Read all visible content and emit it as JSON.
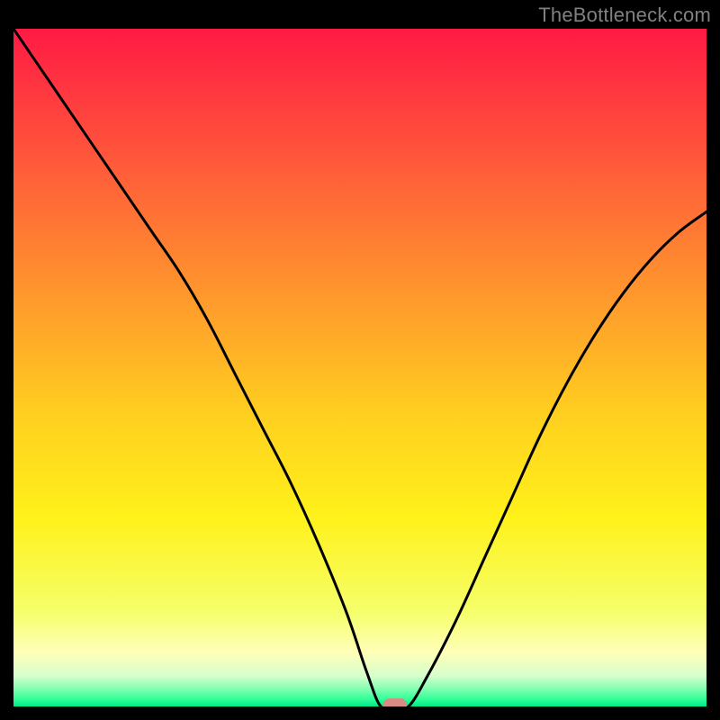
{
  "watermark": "TheBottleneck.com",
  "colors": {
    "black": "#000000",
    "watermark": "#808080",
    "curve": "#000000",
    "marker": "#d98b84",
    "gradient_stops": [
      {
        "offset": 0.0,
        "color": "#ff1a44"
      },
      {
        "offset": 0.2,
        "color": "#ff5a3a"
      },
      {
        "offset": 0.4,
        "color": "#ff9a2c"
      },
      {
        "offset": 0.58,
        "color": "#ffd21f"
      },
      {
        "offset": 0.72,
        "color": "#fff11a"
      },
      {
        "offset": 0.86,
        "color": "#f5ff6a"
      },
      {
        "offset": 0.92,
        "color": "#ffffb8"
      },
      {
        "offset": 0.955,
        "color": "#d6ffcc"
      },
      {
        "offset": 0.975,
        "color": "#7dffb0"
      },
      {
        "offset": 0.99,
        "color": "#2bff95"
      },
      {
        "offset": 1.0,
        "color": "#00e887"
      }
    ]
  },
  "chart_data": {
    "type": "line",
    "title": "",
    "xlabel": "",
    "ylabel": "",
    "xlim": [
      0,
      100
    ],
    "ylim": [
      0,
      100
    ],
    "grid": false,
    "legend": false,
    "annotations": [
      {
        "type": "marker",
        "x": 55,
        "y": 0,
        "shape": "pill",
        "color": "#d98b84"
      }
    ],
    "series": [
      {
        "name": "bottleneck-curve",
        "color": "#000000",
        "x": [
          0,
          4,
          8,
          12,
          16,
          20,
          24,
          28,
          32,
          36,
          40,
          44,
          48,
          51,
          53,
          55,
          57,
          60,
          64,
          68,
          72,
          76,
          80,
          84,
          88,
          92,
          96,
          100
        ],
        "values": [
          100,
          94,
          88,
          82,
          76,
          70,
          64,
          57,
          49,
          41,
          33,
          24,
          14,
          5,
          0,
          0,
          0,
          5,
          13,
          22,
          31,
          40,
          48,
          55,
          61,
          66,
          70,
          73
        ]
      }
    ]
  }
}
